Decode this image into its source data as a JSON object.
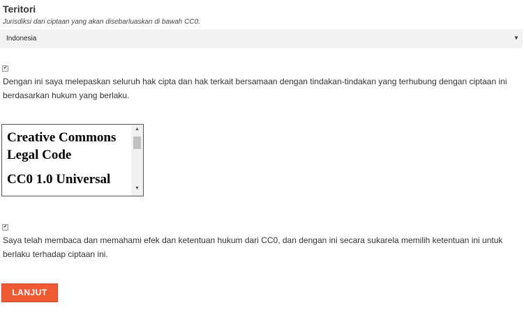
{
  "territory": {
    "title": "Teritori",
    "help_text": "Jurisdiksi dari ciptaan yang akan disebarluaskan di bawah CC0.",
    "selected_value": "Indonesia"
  },
  "waiver": {
    "checked": true,
    "text": "Dengan ini saya melepaskan seluruh hak cipta dan hak terkait bersamaan dengan tindakan-tindakan yang terhubung dengan ciptaan ini berdasarkan hukum yang berlaku."
  },
  "legal_code": {
    "title": "Creative Commons Legal Code",
    "subtitle": "CC0 1.0 Universal"
  },
  "confirmation": {
    "checked": true,
    "text": "Saya telah membaca dan memahami efek dan ketentuan hukum dari CC0, dan dengan ini secara sukarela memilih ketentuan ini untuk berlaku terhadap ciptaan ini."
  },
  "submit": {
    "label": "LANJUT",
    "color": "#ef5a33"
  },
  "icons": {
    "select_arrow": "chevron-down-icon",
    "checkbox_mark": "check-icon",
    "scroll_up": "arrow-up-icon",
    "scroll_down": "arrow-down-icon"
  }
}
